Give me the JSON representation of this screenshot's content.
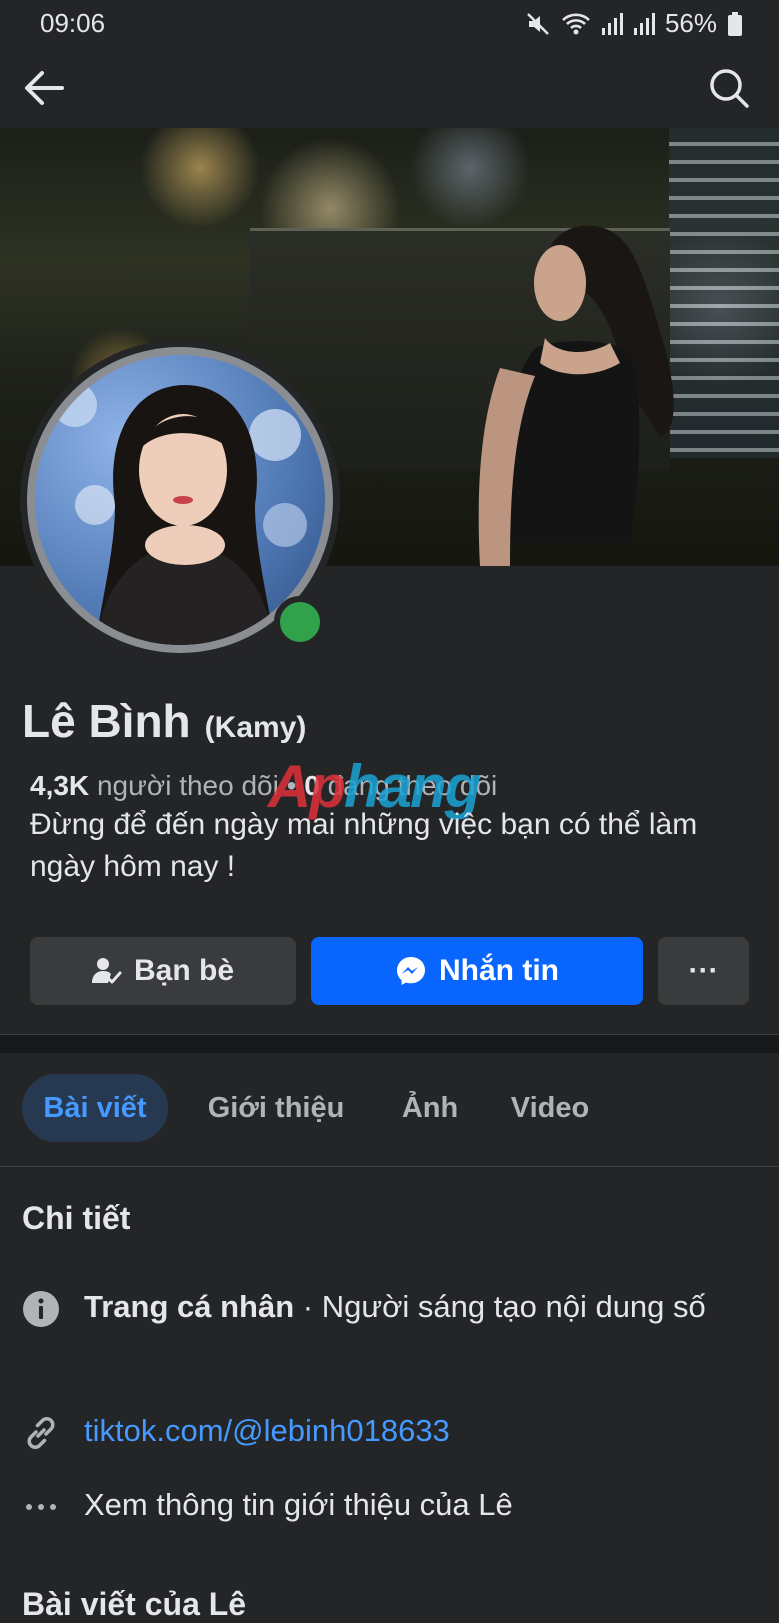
{
  "status_bar": {
    "time": "09:06",
    "battery": "56%"
  },
  "app_bar": {
    "back_icon": "arrow-left-icon",
    "search_icon": "search-icon"
  },
  "profile": {
    "name": "Lê Bình",
    "alternate_name": "(Kamy)",
    "followers_count": "4,3K",
    "followers_label": "người theo dõi",
    "separator": "•",
    "following_count": "0",
    "following_label": "đang theo dõi",
    "bio": "Đừng để đến ngày mai những việc bạn có thể làm ngày hôm nay !",
    "online": true
  },
  "watermark": {
    "part1": "Ap",
    "part2": "hang"
  },
  "actions": {
    "friends_label": "Bạn bè",
    "message_label": "Nhắn tin",
    "more_label": "···"
  },
  "tabs": [
    {
      "label": "Bài viết",
      "active": true
    },
    {
      "label": "Giới thiệu",
      "active": false
    },
    {
      "label": "Ảnh",
      "active": false
    },
    {
      "label": "Video",
      "active": false
    }
  ],
  "details": {
    "title": "Chi tiết",
    "category_bold": "Trang cá nhân",
    "category_rest": " · Người sáng tạo nội dung số",
    "link": "tiktok.com/@lebinh018633",
    "see_about": "Xem thông tin giới thiệu của Lê"
  },
  "posts_title_partial": "Bài viết của Lê",
  "colors": {
    "background": "#242526",
    "primary_blue": "#0866ff",
    "link_blue": "#4599ff",
    "online_green": "#31a24c",
    "secondary_button": "#3a3b3c"
  }
}
